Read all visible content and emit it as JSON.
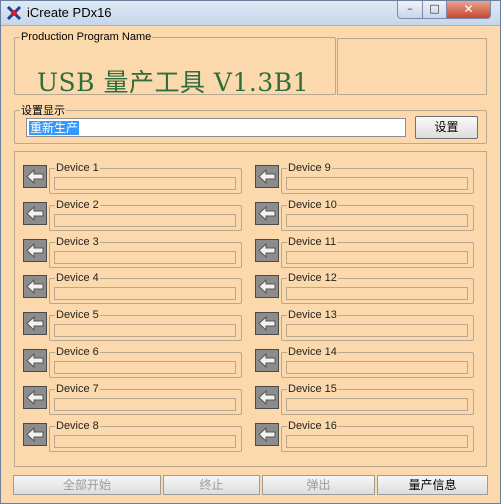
{
  "window": {
    "title": "iCreate PDx16"
  },
  "header": {
    "legend": "Production Program Name",
    "title": "USB 量产工具 V1.3B1"
  },
  "display": {
    "legend": "设置显示",
    "value": "重新生产",
    "set_label": "设置"
  },
  "devices": [
    "Device 1",
    "Device 2",
    "Device 3",
    "Device 4",
    "Device 5",
    "Device 6",
    "Device 7",
    "Device 8",
    "Device 9",
    "Device 10",
    "Device 11",
    "Device 12",
    "Device 13",
    "Device 14",
    "Device 15",
    "Device 16"
  ],
  "footer": {
    "start_all": "全部开始",
    "stop": "终止",
    "eject": "弹出",
    "info": "量产信息"
  },
  "colors": {
    "background": "#fbd9ad",
    "title_text": "#2f6d3d",
    "selection": "#3399ff"
  }
}
